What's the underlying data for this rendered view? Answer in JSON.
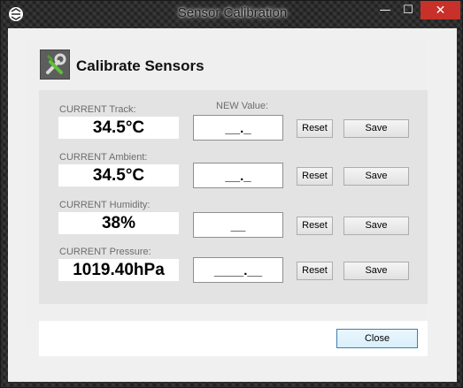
{
  "window": {
    "title": "Sensor Calibration",
    "buttons": {
      "minimize": "—",
      "maximize": "☐",
      "close": "✕"
    }
  },
  "header": {
    "title": "Calibrate Sensors",
    "icon": "tools-icon"
  },
  "new_value_label": "NEW Value:",
  "sensors": [
    {
      "label": "CURRENT Track:",
      "current": "34.5°C",
      "new_placeholder": "__._",
      "reset_label": "Reset",
      "save_label": "Save"
    },
    {
      "label": "CURRENT Ambient:",
      "current": "34.5°C",
      "new_placeholder": "__._",
      "reset_label": "Reset",
      "save_label": "Save"
    },
    {
      "label": "CURRENT Humidity:",
      "current": "38%",
      "new_placeholder": "__",
      "reset_label": "Reset",
      "save_label": "Save"
    },
    {
      "label": "CURRENT Pressure:",
      "current": "1019.40hPa",
      "new_placeholder": "____.__",
      "reset_label": "Reset",
      "save_label": "Save"
    }
  ],
  "footer": {
    "close_label": "Close"
  },
  "colors": {
    "close_button": "#c7312a",
    "accent_border": "#3c7fb1"
  }
}
